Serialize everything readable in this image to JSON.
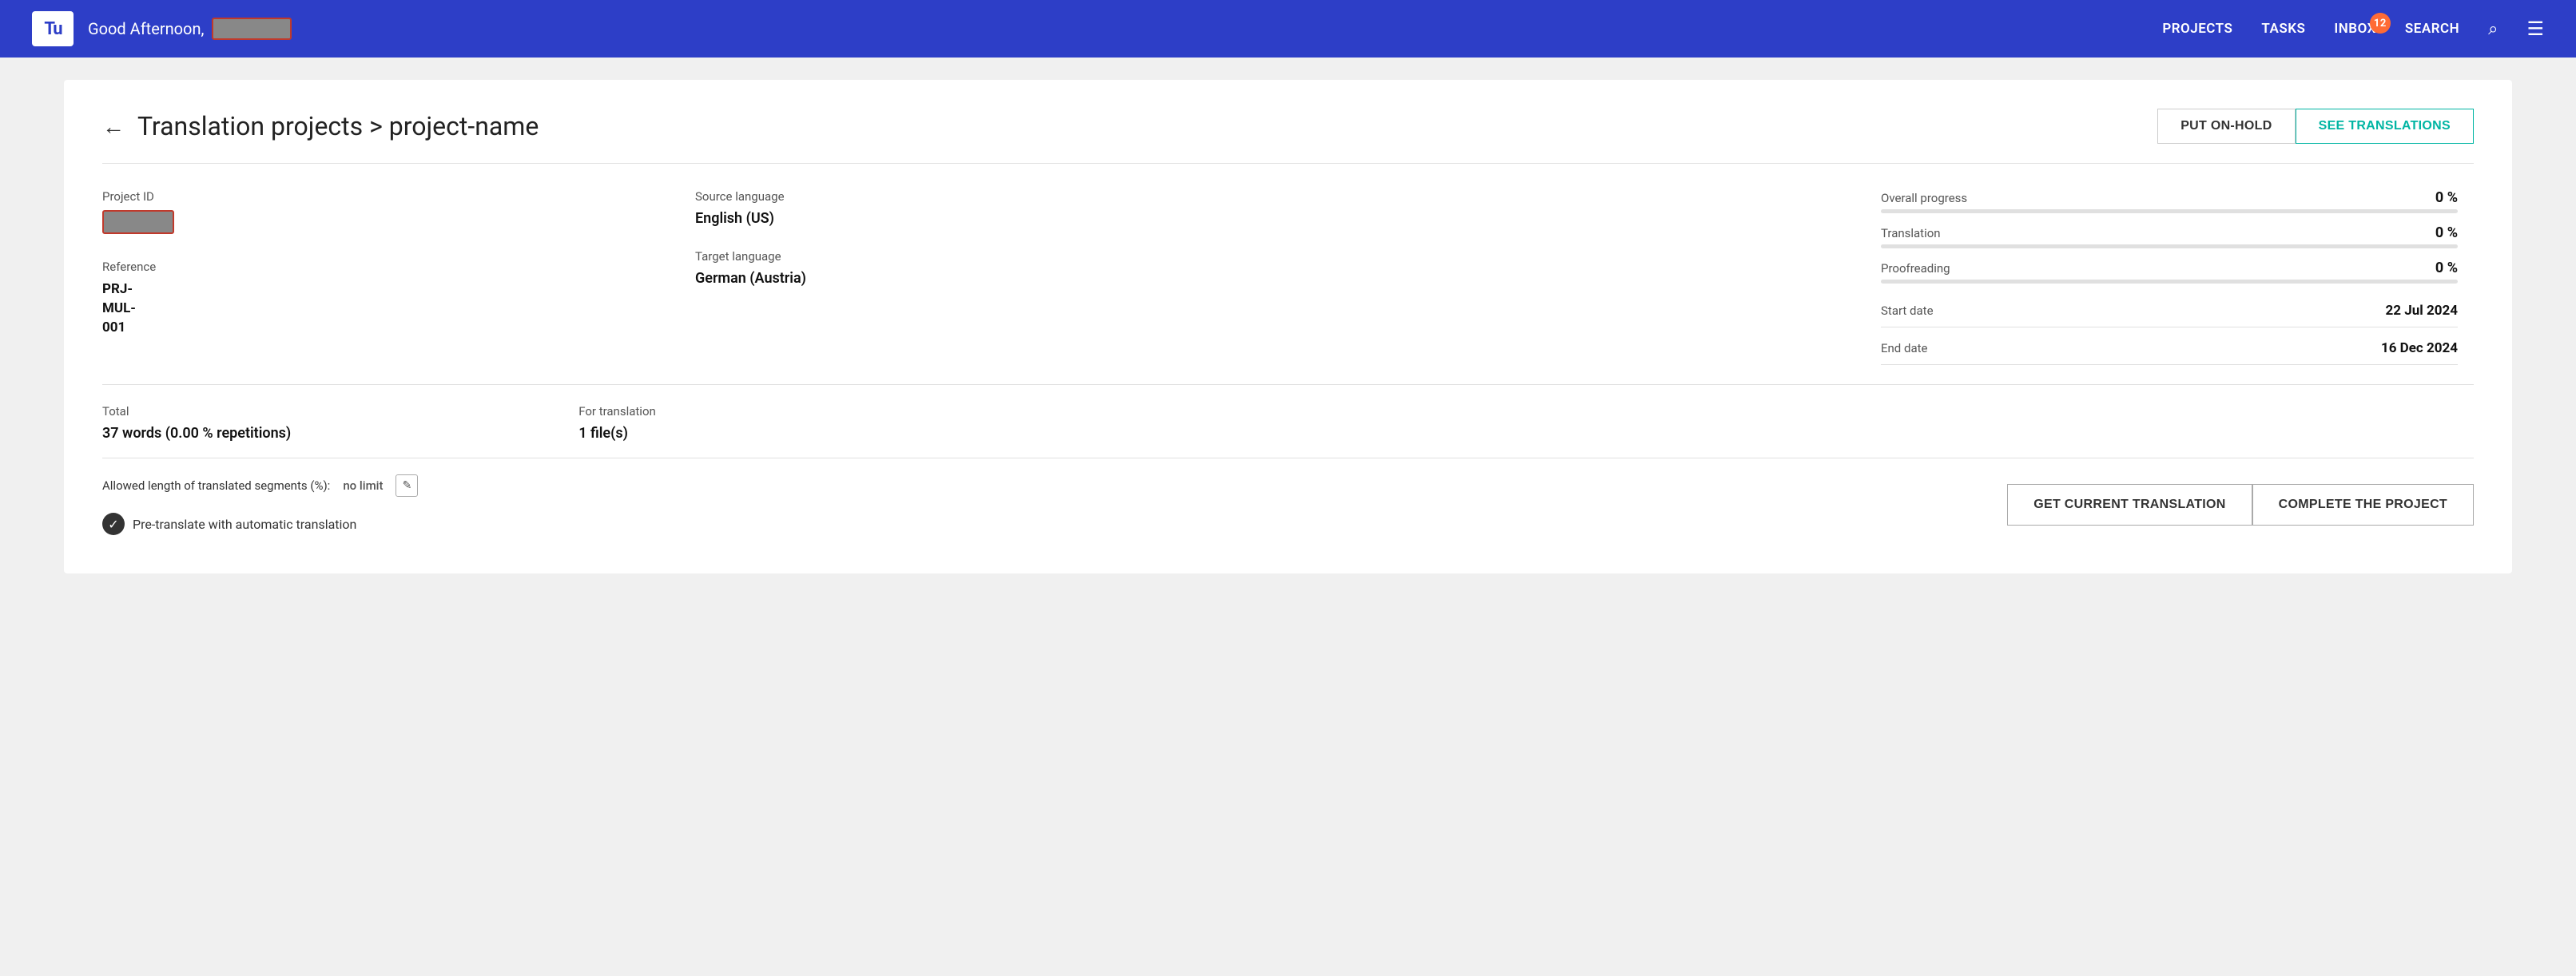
{
  "header": {
    "logo": "Tu",
    "greeting": "Good Afternoon,",
    "username_placeholder": "",
    "nav": {
      "projects": "PROJECTS",
      "tasks": "TASKS",
      "inbox": "INBOX",
      "inbox_badge": "12",
      "search": "SEARCH"
    }
  },
  "breadcrumb": {
    "back_label": "←",
    "title": "Translation projects > project-name"
  },
  "actions": {
    "put_on_hold": "PUT ON-HOLD",
    "see_translations": "SEE TRANSLATIONS"
  },
  "project": {
    "project_id_label": "Project ID",
    "source_language_label": "Source language",
    "source_language": "English (US)",
    "target_language_label": "Target language",
    "target_language": "German (Austria)",
    "overall_progress_label": "Overall progress",
    "overall_progress": "0 %",
    "translation_label": "Translation",
    "translation_pct": "0 %",
    "proofreading_label": "Proofreading",
    "proofreading_pct": "0 %",
    "reference_label": "Reference",
    "reference_value": "PRJ-MUL-001",
    "total_label": "Total",
    "total_value": "37 words (0.00 % repetitions)",
    "for_translation_label": "For translation",
    "for_translation_value": "1 file(s)",
    "start_date_label": "Start date",
    "start_date": "22 Jul 2024",
    "end_date_label": "End date",
    "end_date": "16 Dec 2024",
    "allowed_length_label": "Allowed length of translated segments (%):",
    "no_limit": "no limit",
    "pretranslate_label": "Pre-translate with automatic translation"
  },
  "bottom_actions": {
    "get_current": "GET CURRENT TRANSLATION",
    "complete": "COMPLETE THE PROJECT"
  }
}
